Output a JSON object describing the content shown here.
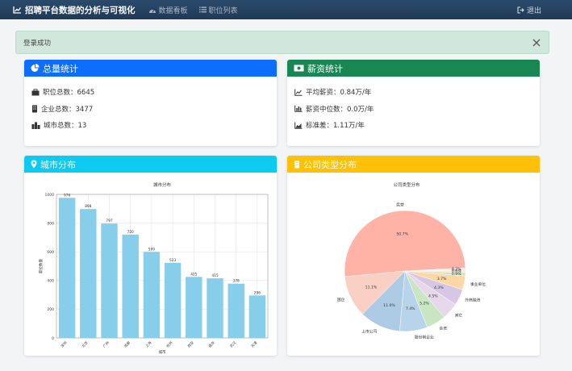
{
  "navbar": {
    "brand": "招聘平台数据的分析与可视化",
    "links": [
      "数据看板",
      "职位列表"
    ],
    "logout": "退出"
  },
  "alert": {
    "message": "登录成功"
  },
  "total_card": {
    "title": "总量统计",
    "rows": [
      "职位总数：6645",
      "企业总数：3477",
      "城市总数：13"
    ]
  },
  "salary_card": {
    "title": "薪资统计",
    "rows": [
      "平均薪资：0.84万/年",
      "薪资中位数：0.0万/年",
      "标准差：1.11万/年"
    ]
  },
  "city_card": {
    "title": "城市分布"
  },
  "type_card": {
    "title": "公司类型分布"
  },
  "colors": {
    "primary": "#0d6efd",
    "success": "#198754",
    "info": "#0dcaf0",
    "warning": "#ffc107",
    "alert_bg": "#d1e7dd",
    "bar": "#87ceeb"
  },
  "chart_data": [
    {
      "type": "bar",
      "title": "城市分布",
      "xlabel": "城市",
      "ylabel": "职位数量",
      "categories": [
        "深圳",
        "北京",
        "广州",
        "成都",
        "上海",
        "杭州",
        "西安",
        "南京",
        "武汉",
        "天津"
      ],
      "values": [
        976,
        898,
        797,
        720,
        599,
        523,
        425,
        415,
        378,
        296
      ],
      "ylim": [
        0,
        1000
      ],
      "yticks": [
        0,
        200,
        400,
        600,
        800,
        1000
      ],
      "grid": true
    },
    {
      "type": "pie",
      "title": "公司类型分布",
      "labels": [
        "民营",
        "国企",
        "上市公司",
        "股份制企业",
        "合资",
        "其它",
        "外商独资",
        "事业单位",
        "",
        "",
        "",
        ""
      ],
      "values": [
        50.7,
        11.1,
        11.0,
        7.4,
        5.2,
        4.5,
        4.3,
        3.7,
        0.9,
        0.6,
        0.4,
        0.2
      ],
      "value_labels": [
        "50.7%",
        "11.1%",
        "11.0%",
        "7.4%",
        "5.2%",
        "4.5%",
        "4.3%",
        "3.7%",
        "0.9%",
        "0.6%",
        "0.4%",
        "0.2%"
      ],
      "colors": [
        "#ffb3a7",
        "#fad0c4",
        "#aecbe6",
        "#b7d4ea",
        "#c7e6c1",
        "#e6d7ea",
        "#d7c6e4",
        "#fdd7a6",
        "#c8e6c9",
        "#fde8c8",
        "#e0e0f0",
        "#f0d0d0"
      ]
    }
  ]
}
